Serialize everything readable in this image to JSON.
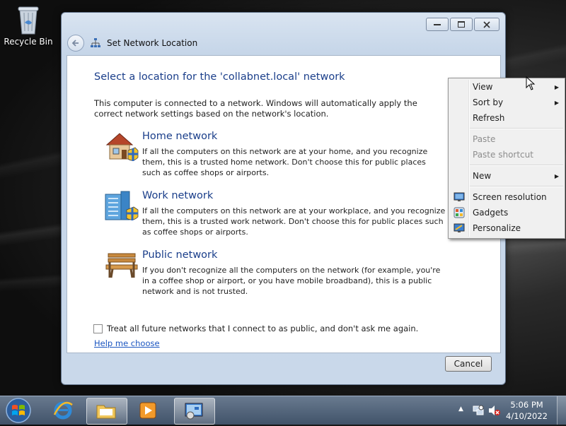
{
  "desktop": {
    "recycle_bin_label": "Recycle Bin"
  },
  "window": {
    "title": "Set Network Location",
    "heading": "Select a location for the 'collabnet.local' network",
    "intro": "This computer is connected to a network. Windows will automatically apply the correct network settings based on the network's location.",
    "options": [
      {
        "title": "Home network",
        "desc": "If all the computers on this network are at your home, and you recognize them, this is a trusted home network.  Don't choose this for public places such as coffee shops or airports.",
        "icon": "house-icon"
      },
      {
        "title": "Work network",
        "desc": "If all the computers on this network are at your workplace, and you recognize them, this is a trusted work network.  Don't choose this for public places such as coffee shops or airports.",
        "icon": "office-building-icon"
      },
      {
        "title": "Public network",
        "desc": "If you don't recognize all the computers on the network (for example, you're in a coffee shop or airport, or you have mobile broadband), this is a public network and is not trusted.",
        "icon": "park-bench-icon"
      }
    ],
    "checkbox_label": "Treat all future networks that I connect to as public, and don't ask me again.",
    "help_link": "Help me choose",
    "cancel_label": "Cancel"
  },
  "context_menu": {
    "items": [
      {
        "label": "View",
        "submenu": true
      },
      {
        "label": "Sort by",
        "submenu": true
      },
      {
        "label": "Refresh"
      },
      {
        "label": "Paste",
        "disabled": true
      },
      {
        "label": "Paste shortcut",
        "disabled": true
      },
      {
        "label": "New",
        "submenu": true
      },
      {
        "label": "Screen resolution",
        "icon": "monitor-icon"
      },
      {
        "label": "Gadgets",
        "icon": "gadgets-icon"
      },
      {
        "label": "Personalize",
        "icon": "personalize-icon"
      }
    ]
  },
  "taskbar": {
    "clock_time": "5:06 PM",
    "clock_date": "4/10/2022"
  },
  "colors": {
    "heading_blue": "#1a3e8a",
    "link_blue": "#1a55c0"
  }
}
